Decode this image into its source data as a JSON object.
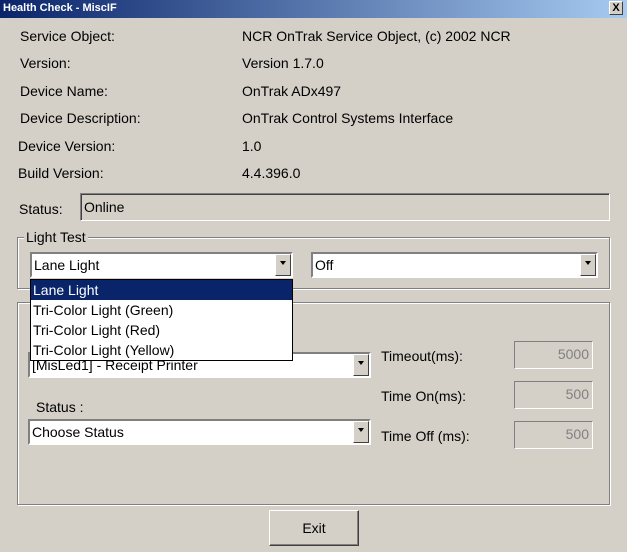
{
  "window": {
    "title": "Health Check - MiscIF",
    "close_label": "X"
  },
  "info": [
    {
      "label": "Service Object:",
      "value": "NCR OnTrak Service Object, (c) 2002 NCR"
    },
    {
      "label": "Version:",
      "value": "Version 1.7.0"
    },
    {
      "label": "Device Name:",
      "value": "OnTrak ADx497"
    },
    {
      "label": "Device Description:",
      "value": "OnTrak Control Systems Interface"
    },
    {
      "label": "Device Version:",
      "value": "1.0"
    },
    {
      "label": "Build Version:",
      "value": "4.4.396.0"
    }
  ],
  "status": {
    "label": "Status:",
    "value": "Online"
  },
  "light_test": {
    "legend": "Light Test",
    "light_select": "Lane Light",
    "state_select": "Off",
    "options": [
      "Lane Light",
      "Tri-Color Light (Green)",
      "Tri-Color Light (Red)",
      "Tri-Color Light (Yellow)"
    ],
    "selected_index": 0
  },
  "led": {
    "device_select": "[MisLed1] - Receipt Printer",
    "status_label": "Status :",
    "status_select": "Choose Status",
    "timeout_label": "Timeout(ms):",
    "timeout_value": "5000",
    "time_on_label": "Time On(ms):",
    "time_on_value": "500",
    "time_off_label": "Time Off (ms):",
    "time_off_value": "500"
  },
  "exit_label": "Exit"
}
